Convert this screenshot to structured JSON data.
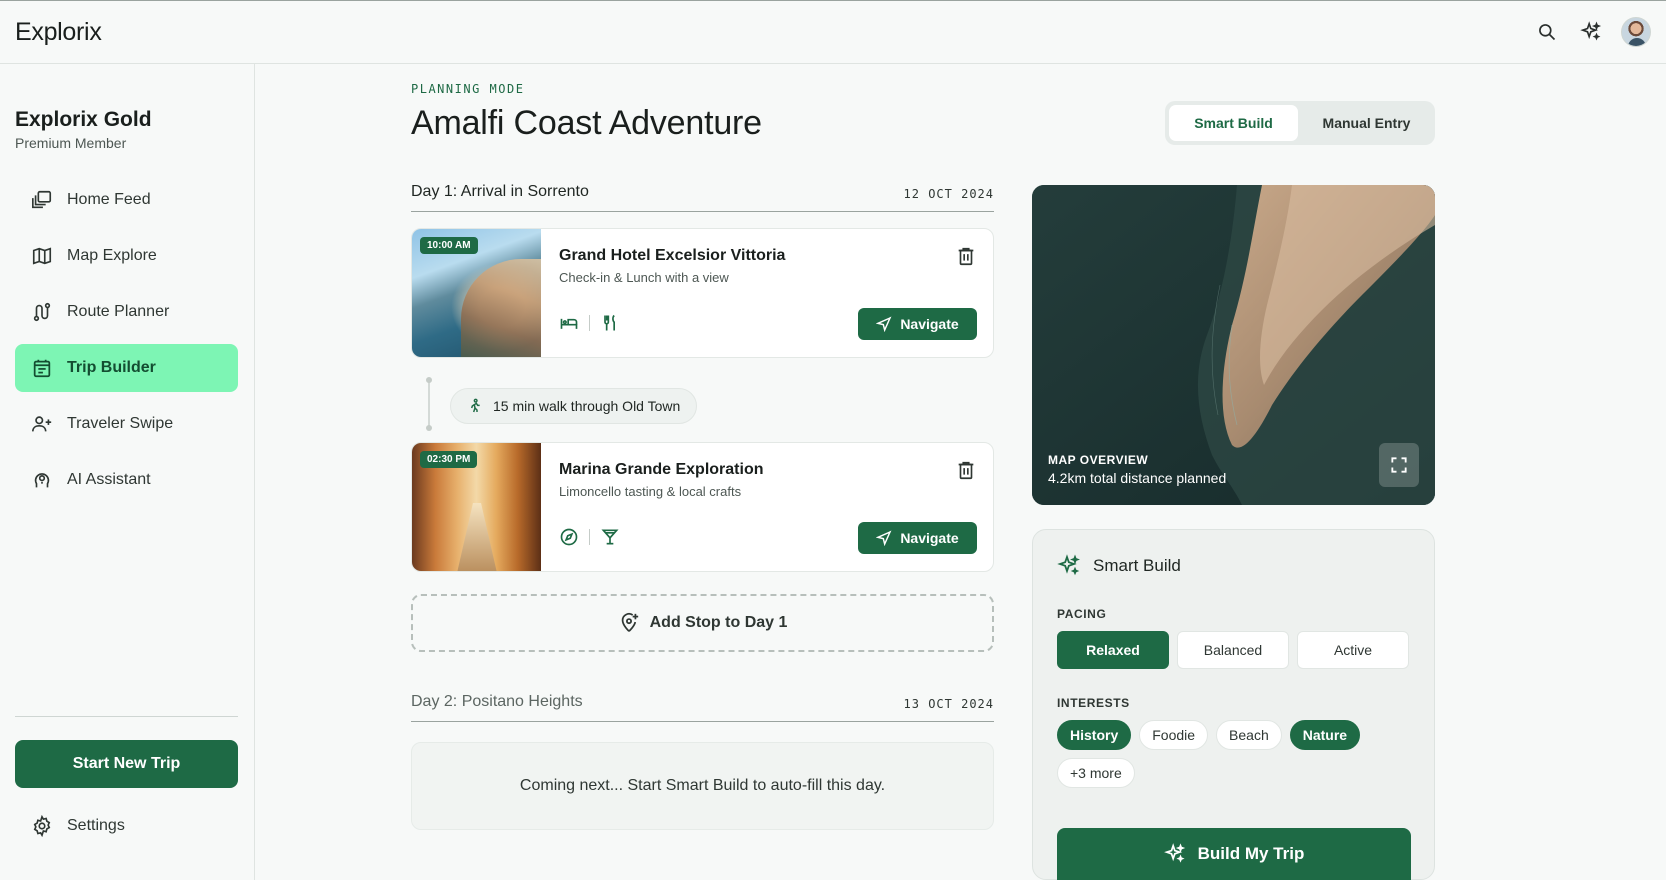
{
  "app": {
    "brand": "Explorix"
  },
  "member": {
    "name": "Explorix Gold",
    "tier": "Premium Member"
  },
  "nav": {
    "items": [
      {
        "label": "Home Feed",
        "icon": "home-feed-icon"
      },
      {
        "label": "Map Explore",
        "icon": "map-icon"
      },
      {
        "label": "Route Planner",
        "icon": "route-icon"
      },
      {
        "label": "Trip Builder",
        "icon": "calendar-icon",
        "active": true
      },
      {
        "label": "Traveler Swipe",
        "icon": "add-user-icon"
      },
      {
        "label": "AI Assistant",
        "icon": "ai-head-icon"
      }
    ]
  },
  "sidebar": {
    "new_trip": "Start New Trip",
    "settings": "Settings"
  },
  "page": {
    "mode": "PLANNING MODE",
    "title": "Amalfi Coast Adventure",
    "tabs": [
      "Smart Build",
      "Manual Entry"
    ],
    "active_tab": "Smart Build"
  },
  "days": [
    {
      "title": "Day 1: Arrival in Sorrento",
      "date": "12 OCT 2024",
      "stops": [
        {
          "time": "10:00 AM",
          "name": "Grand Hotel Excelsior Vittoria",
          "desc": "Check-in & Lunch with a view",
          "tags": [
            "bed-icon",
            "utensils-icon"
          ],
          "action": "Navigate"
        },
        {
          "time": "02:30 PM",
          "name": "Marina Grande Exploration",
          "desc": "Limoncello tasting & local crafts",
          "tags": [
            "compass-icon",
            "cocktail-icon"
          ],
          "action": "Navigate"
        }
      ],
      "transit": "15 min walk through Old Town",
      "add_stop": "Add Stop to Day 1"
    },
    {
      "title": "Day 2: Positano Heights",
      "date": "13 OCT 2024",
      "placeholder": "Coming next... Start Smart Build to auto-fill this day."
    }
  ],
  "map": {
    "label": "MAP OVERVIEW",
    "distance": "4.2km total distance planned"
  },
  "smart_build": {
    "title": "Smart Build",
    "pacing_label": "PACING",
    "pacing": [
      "Relaxed",
      "Balanced",
      "Active"
    ],
    "pacing_selected": "Relaxed",
    "interests_label": "INTERESTS",
    "interests": [
      {
        "label": "History",
        "on": true
      },
      {
        "label": "Foodie",
        "on": false
      },
      {
        "label": "Beach",
        "on": false
      },
      {
        "label": "Nature",
        "on": true
      },
      {
        "label": "+3 more",
        "on": false
      }
    ],
    "cta": "Build My Trip"
  },
  "colors": {
    "accent": "#1e6a45",
    "active_nav": "#7df5b4",
    "background": "#f7f9f8"
  }
}
